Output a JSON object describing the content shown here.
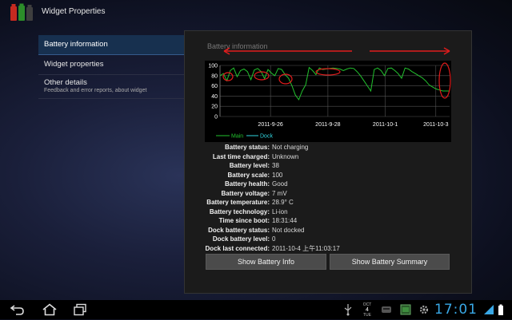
{
  "app": {
    "title": "Widget Properties",
    "icon": "battery-widget-icon"
  },
  "nav": {
    "items": [
      {
        "label": "Battery information",
        "active": true
      },
      {
        "label": "Widget properties",
        "active": false
      },
      {
        "label": "Other details",
        "sub": "Feedback and error reports, about widget",
        "active": false
      }
    ]
  },
  "panel": {
    "title": "Battery information"
  },
  "chart_data": {
    "type": "line",
    "ylim": [
      0,
      100
    ],
    "yticks": [
      "100",
      "80",
      "60",
      "40",
      "20",
      "0"
    ],
    "xticks": [
      "2011-9-26",
      "2011-9-28",
      "2011-10-1",
      "2011-10-3"
    ],
    "legend": [
      "Main",
      "Dock"
    ],
    "colors": {
      "main": "#22c22e",
      "dock": "#31d6e0",
      "annotation": "#e11c1c"
    },
    "series": [
      {
        "name": "Main",
        "values": [
          80,
          84,
          70,
          90,
          95,
          78,
          90,
          93,
          88,
          72,
          91,
          94,
          88,
          74,
          92,
          85,
          80,
          94,
          92,
          82,
          75,
          60,
          42,
          33,
          50,
          62,
          96,
          90,
          82,
          95,
          92,
          93,
          94,
          95,
          94,
          93,
          90,
          93,
          95,
          94,
          88,
          80,
          70,
          60,
          50,
          92,
          95,
          90,
          80,
          94,
          95,
          90,
          84,
          75,
          95,
          93,
          88,
          84,
          80,
          76,
          70,
          62,
          58,
          54,
          52,
          50,
          50,
          50
        ]
      },
      {
        "name": "Dock",
        "values": []
      }
    ]
  },
  "info": [
    {
      "label": "Battery status:",
      "value": "Not charging"
    },
    {
      "label": "Last time charged:",
      "value": "Unknown"
    },
    {
      "label": "Battery level:",
      "value": "38"
    },
    {
      "label": "Battery scale:",
      "value": "100"
    },
    {
      "label": "Battery health:",
      "value": "Good"
    },
    {
      "label": "Battery voltage:",
      "value": "7 mV"
    },
    {
      "label": "Battery temperature:",
      "value": "28.9° C"
    },
    {
      "label": "Battery technology:",
      "value": "Li-ion"
    },
    {
      "label": "Time since boot:",
      "value": "18:31:44"
    },
    {
      "label": "Dock battery status:",
      "value": "Not docked"
    },
    {
      "label": "Dock battery level:",
      "value": "0"
    },
    {
      "label": "Dock last connected:",
      "value": "2011-10-4 上午11:03:17"
    }
  ],
  "buttons": {
    "info": "Show Battery Info",
    "summary": "Show Battery Summary"
  },
  "status_bar": {
    "time": "17:01",
    "date": [
      "OCT",
      "4",
      "TUE"
    ],
    "icons": [
      "back-icon",
      "home-icon",
      "recent-apps-icon",
      "usb-icon",
      "keyboard-icon",
      "screenshot-icon",
      "settings-icon",
      "wifi-icon",
      "battery-icon"
    ]
  }
}
